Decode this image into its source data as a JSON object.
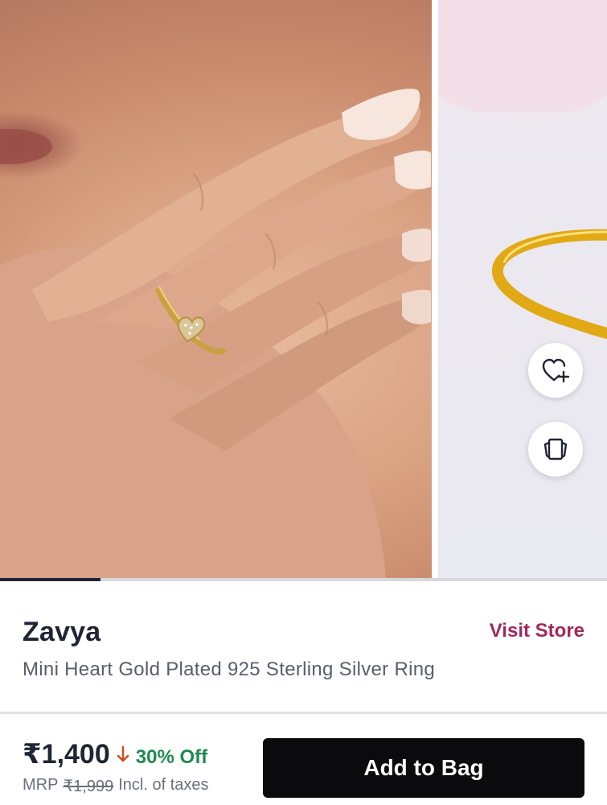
{
  "carousel": {
    "slides": [
      {
        "image": "model-hand-wearing-gold-heart-ring"
      },
      {
        "image": "gold-ring-product-shot"
      }
    ],
    "current_slide": 1,
    "total_slides": 6,
    "progress_fraction": 0.166
  },
  "actions": {
    "wishlist_icon": "heart-plus-icon",
    "similar_icon": "view-similar-icon"
  },
  "product": {
    "brand": "Zavya",
    "visit_store_label": "Visit Store",
    "name": "Mini Heart Gold Plated 925 Sterling Silver Ring"
  },
  "pricing": {
    "price": "₹1,400",
    "discount": "30% Off",
    "mrp_label": "MRP",
    "mrp_value": "₹1,999",
    "tax_note": "Incl. of taxes"
  },
  "cta": {
    "add_to_bag_label": "Add to Bag"
  },
  "colors": {
    "brand_accent": "#a3285a",
    "discount_green": "#1e8a4f",
    "cta_background": "#0b0b0e"
  }
}
